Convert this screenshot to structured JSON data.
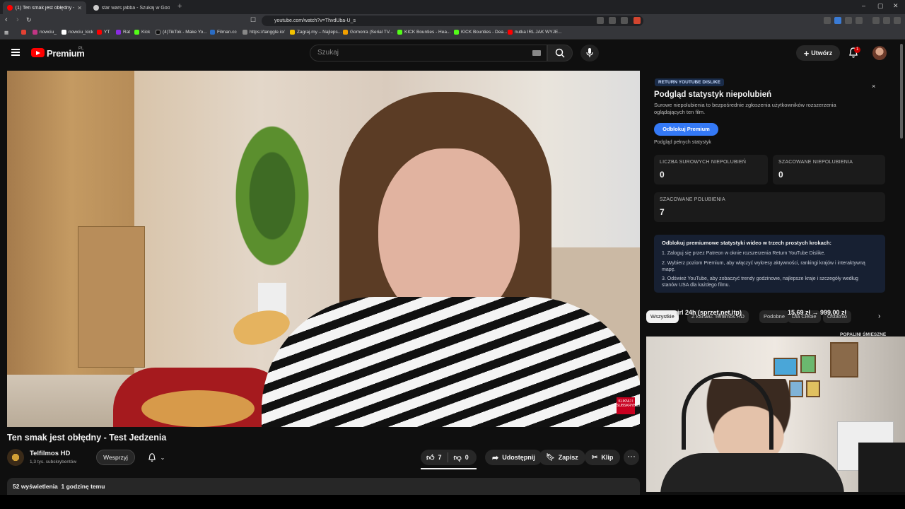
{
  "browser": {
    "tabs": [
      {
        "title": "(1) Ten smak jest obłędny - Te",
        "active": true,
        "favicon_color": "#ff0000"
      },
      {
        "title": "star wars jabba - Szukaj w Google",
        "active": false,
        "favicon_color": "#cccccc"
      }
    ],
    "new_tab": "+",
    "window_controls": {
      "minimize": "–",
      "maximize": "▢",
      "close": "✕"
    },
    "url": "youtube.com/watch?v=ThvdUba-U_s",
    "bookmarks": [
      {
        "label": "",
        "color": "#e34133"
      },
      {
        "label": "nowciu_",
        "color": "#c13584"
      },
      {
        "label": "nowciu_kick",
        "color": "#ffffff"
      },
      {
        "label": "YT",
        "color": "#ff0000"
      },
      {
        "label": "Rat",
        "color": "#8a2be2"
      },
      {
        "label": "Kick",
        "color": "#53fc18"
      },
      {
        "label": "(4)TikTok - Make Yo...",
        "color": "#111111"
      },
      {
        "label": "Filman.cc",
        "color": "#2a6cc4"
      },
      {
        "label": "https://tanggle.io/",
        "color": "#888888"
      },
      {
        "label": "Zagraj.my – Najleps...",
        "color": "#f2c200"
      },
      {
        "label": "Gomorra (Serial TV...",
        "color": "#f2a000"
      },
      {
        "label": "KICK Bounties - Hea...",
        "color": "#53fc18"
      },
      {
        "label": "KICK Bounties - Dea...",
        "color": "#53fc18"
      },
      {
        "label": "nutka IRL JAK WYJE...",
        "color": "#ff0000"
      }
    ]
  },
  "header": {
    "brand": "Premium",
    "region": "PL",
    "search_placeholder": "Szukaj",
    "create_label": "Utwórz",
    "notification_count": "1"
  },
  "video": {
    "title": "Ten smak jest obłędny - Test Jedzenia",
    "watermark": "KLIKNIJ I SUBSKRYBUJ",
    "channel_name": "Telfilmos HD",
    "subscribers": "1,3 tys. subskrybentów",
    "support_label": "Wesprzyj",
    "likes": "7",
    "dislikes": "0",
    "like_ratio": 1.0,
    "share_label": "Udostępnij",
    "save_label": "Zapisz",
    "clip_label": "Klip",
    "views": "52 wyświetlenia",
    "published": "1 godzinę temu"
  },
  "ryd": {
    "badge": "RETURN YOUTUBE DISLIKE",
    "close": "×",
    "title": "Podgląd statystyk niepolubień",
    "description": "Surowe niepolubienia to bezpośrednie zgłoszenia użytkowników rozszerzenia oglądających ten film.",
    "unlock_label": "Odblokuj Premium",
    "full_stats_label": "Podgląd pełnych statystyk",
    "stats": [
      {
        "label": "LICZBA SUROWYCH NIEPOLUBIEŃ",
        "value": "0"
      },
      {
        "label": "SZACOWANE NIEPOLUBIENIA",
        "value": "0"
      },
      {
        "label": "SZACOWANE POLUBIENIA",
        "value": "7"
      }
    ],
    "promo_title": "Odblokuj premiumowe statystyki wideo w trzech prostych krokach:",
    "promo_steps": [
      "1.  Zaloguj się przez Patreon w oknie rozszerzenia Return YouTube Dislike.",
      "2.  Wybierz poziom Premium, aby włączyć wykresy aktywności, rankingi krajów i interaktywną mapę.",
      "3.  Odśwież YouTube, aby zobaczyć trendy godzinowe, najlepsze kraje i szczegóły według stanów USA dla każdego filmu."
    ]
  },
  "chips": {
    "items": [
      "Wszystkie",
      "Z kanału: Telfilmos HD",
      "Podobne",
      "Dla Ciebie",
      "Ostatnio"
    ],
    "overlay_text": "irl 24h (sprzet,net,itp)",
    "overlay_price": "15,69 zł  →  999,00 zł"
  },
  "sidebar": {
    "first_video_title": "POPALINI ŚMIESZNE"
  }
}
